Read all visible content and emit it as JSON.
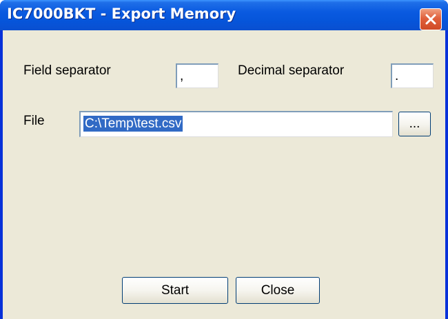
{
  "window": {
    "title": "IC7000BKT - Export Memory"
  },
  "form": {
    "field_separator_label": "Field separator",
    "field_separator_value": ",",
    "decimal_separator_label": "Decimal separator",
    "decimal_separator_value": ".",
    "file_label": "File",
    "file_value": "C:\\Temp\\test.csv",
    "browse_label": "..."
  },
  "buttons": {
    "start_label": "Start",
    "close_label": "Close"
  },
  "icons": {
    "close": "close-icon"
  },
  "colors": {
    "titlebar": "#0a5ae0",
    "close_button": "#d04a26",
    "dialog_background": "#ece9d8",
    "selection": "#316ac5"
  }
}
